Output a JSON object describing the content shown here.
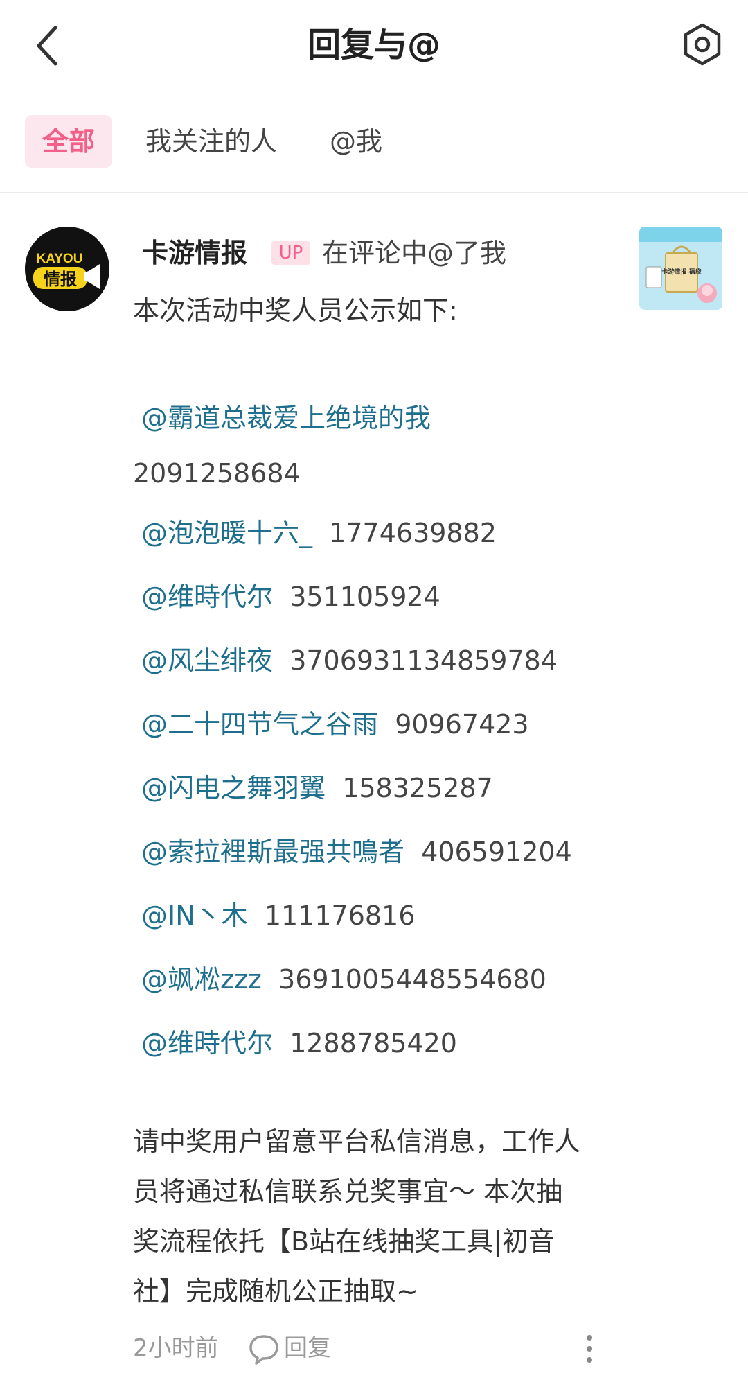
{
  "header": {
    "title": "回复与@",
    "back_icon": "chevron-left-icon",
    "settings_icon": "settings-hexagon-icon"
  },
  "tabs": [
    {
      "label": "全部",
      "active": true
    },
    {
      "label": "我关注的人",
      "active": false
    },
    {
      "label": "@我",
      "active": false
    }
  ],
  "notification": {
    "avatar": {
      "logo_top": "KAYOU",
      "logo_bottom": "情报"
    },
    "username": "卡游情报",
    "badge": "UP",
    "action": "在评论中@了我",
    "intro": "本次活动中奖人员公示如下:",
    "winners": [
      {
        "mention": "@霸道总裁爱上绝境的我",
        "uid": "2091258684"
      },
      {
        "mention": "@泡泡暖十六_",
        "uid": "1774639882"
      },
      {
        "mention": "@维時代尔",
        "uid": "351105924"
      },
      {
        "mention": "@风尘绯夜",
        "uid": "3706931134859784"
      },
      {
        "mention": "@二十四节气之谷雨",
        "uid": "90967423"
      },
      {
        "mention": "@闪电之舞羽翼",
        "uid": "158325287"
      },
      {
        "mention": "@索拉裡斯最强共鳴者",
        "uid": "406591204"
      },
      {
        "mention": "@IN丶木",
        "uid": "111176816"
      },
      {
        "mention": "@飒凇zzz",
        "uid": "3691005448554680"
      },
      {
        "mention": "@维時代尔",
        "uid": "1288785420"
      }
    ],
    "closing_lines": [
      "请中奖用户留意平台私信消息，工作人",
      "员将通过私信联系兑奖事宜～ 本次抽",
      "奖流程依托【B站在线抽奖工具|初音",
      "社】完成随机公正抽取~"
    ],
    "time": "2小时前",
    "reply_label": "回复",
    "thumbnail_text": "卡游情报 福袋"
  },
  "colors": {
    "accent": "#f2608a",
    "tab_active_bg": "#fde7ee",
    "mention": "#1e6e8d"
  }
}
